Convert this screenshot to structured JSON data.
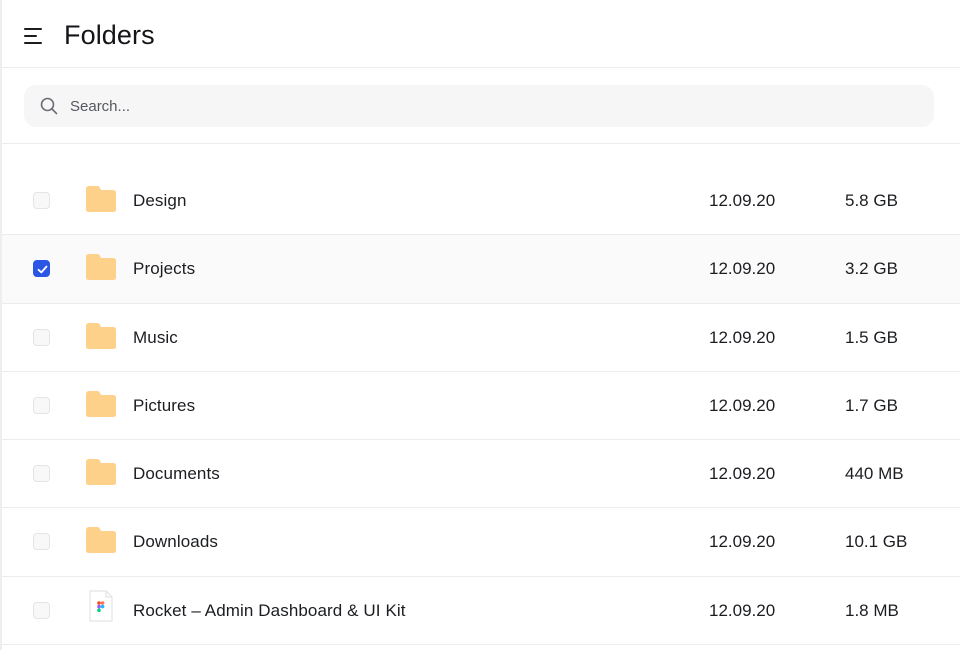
{
  "header": {
    "title": "Folders",
    "menu_icon": "menu-icon"
  },
  "search": {
    "placeholder": "Search...",
    "value": ""
  },
  "colors": {
    "folder": "#fdd18a",
    "checkbox_checked": "#2a55e5",
    "text": "#1b1d21"
  },
  "items": [
    {
      "name": "Design",
      "date": "12.09.20",
      "size": "5.8 GB",
      "type": "folder",
      "checked": false
    },
    {
      "name": "Projects",
      "date": "12.09.20",
      "size": "3.2 GB",
      "type": "folder",
      "checked": true
    },
    {
      "name": "Music",
      "date": "12.09.20",
      "size": "1.5 GB",
      "type": "folder",
      "checked": false
    },
    {
      "name": "Pictures",
      "date": "12.09.20",
      "size": "1.7 GB",
      "type": "folder",
      "checked": false
    },
    {
      "name": "Documents",
      "date": "12.09.20",
      "size": "440 MB",
      "type": "folder",
      "checked": false
    },
    {
      "name": "Downloads",
      "date": "12.09.20",
      "size": "10.1 GB",
      "type": "folder",
      "checked": false
    },
    {
      "name": "Rocket – Admin Dashboard & UI Kit",
      "date": "12.09.20",
      "size": "1.8 MB",
      "type": "figma-file",
      "checked": false
    }
  ]
}
